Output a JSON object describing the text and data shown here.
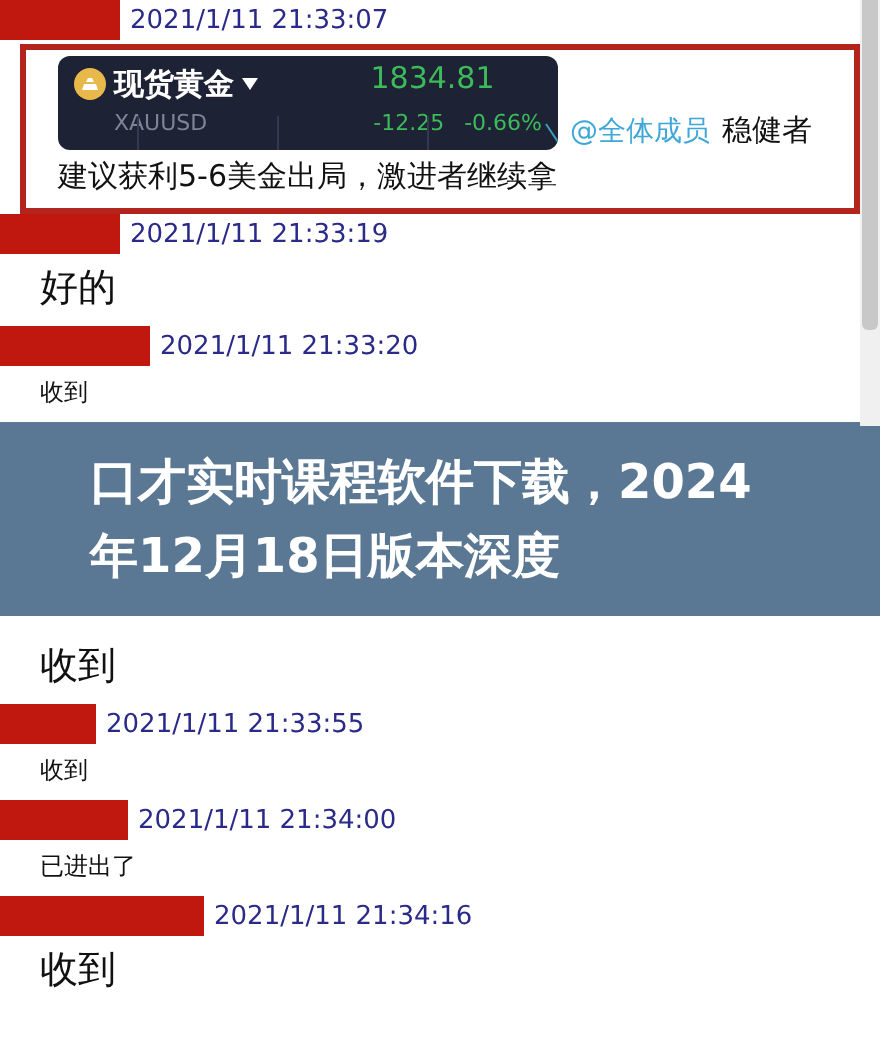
{
  "highlighted_message": {
    "time": "2021/1/11 21:33:07",
    "quote_card": {
      "name": "现货黄金",
      "symbol": "XAUUSD",
      "price": "1834.81",
      "change": "-12.25",
      "change_percent": "-0.66%"
    },
    "mention": "@全体成员",
    "text_1": "稳健者",
    "text_2": "建议获利5-6美金出局，激进者继续拿"
  },
  "messages": [
    {
      "time": "2021/1/11 21:33:19",
      "text": "好的",
      "kind": "large"
    },
    {
      "time": "2021/1/11 21:33:20",
      "text": "收到",
      "kind": "small"
    },
    {
      "kind": "banner",
      "title": "口才实时课程软件下载，2024年12月18日版本深度"
    },
    {
      "text": "收到",
      "kind": "large"
    },
    {
      "time": "2021/1/11 21:33:55",
      "text": "收到",
      "kind": "small"
    },
    {
      "time": "2021/1/11 21:34:00",
      "text": "已进出了",
      "kind": "small"
    },
    {
      "time": "2021/1/11 21:34:16",
      "text": "收到",
      "kind": "large"
    }
  ]
}
